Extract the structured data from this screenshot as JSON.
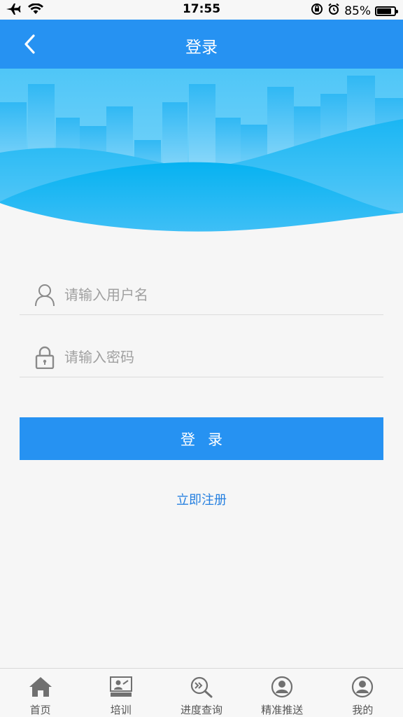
{
  "status_bar": {
    "time": "17:55",
    "battery_text": "85%",
    "battery_level": 0.85,
    "icons": [
      "airplane-icon",
      "wifi-icon",
      "rotation-lock-icon",
      "alarm-icon",
      "battery-icon"
    ]
  },
  "nav": {
    "title": "登录",
    "back_icon": "chevron-left-icon"
  },
  "form": {
    "username_placeholder": "请输入用户名",
    "username_value": "",
    "username_icon": "user-icon",
    "password_placeholder": "请输入密码",
    "password_value": "",
    "password_icon": "lock-icon",
    "login_label": "登录",
    "register_label": "立即注册"
  },
  "tab_bar": {
    "items": [
      {
        "label": "首页",
        "icon": "home-icon"
      },
      {
        "label": "培训",
        "icon": "training-icon"
      },
      {
        "label": "进度查询",
        "icon": "progress-search-icon"
      },
      {
        "label": "精准推送",
        "icon": "push-user-icon"
      },
      {
        "label": "我的",
        "icon": "profile-icon"
      }
    ]
  },
  "colors": {
    "primary": "#2692f2",
    "link": "#2680e0",
    "background": "#f6f6f6"
  }
}
